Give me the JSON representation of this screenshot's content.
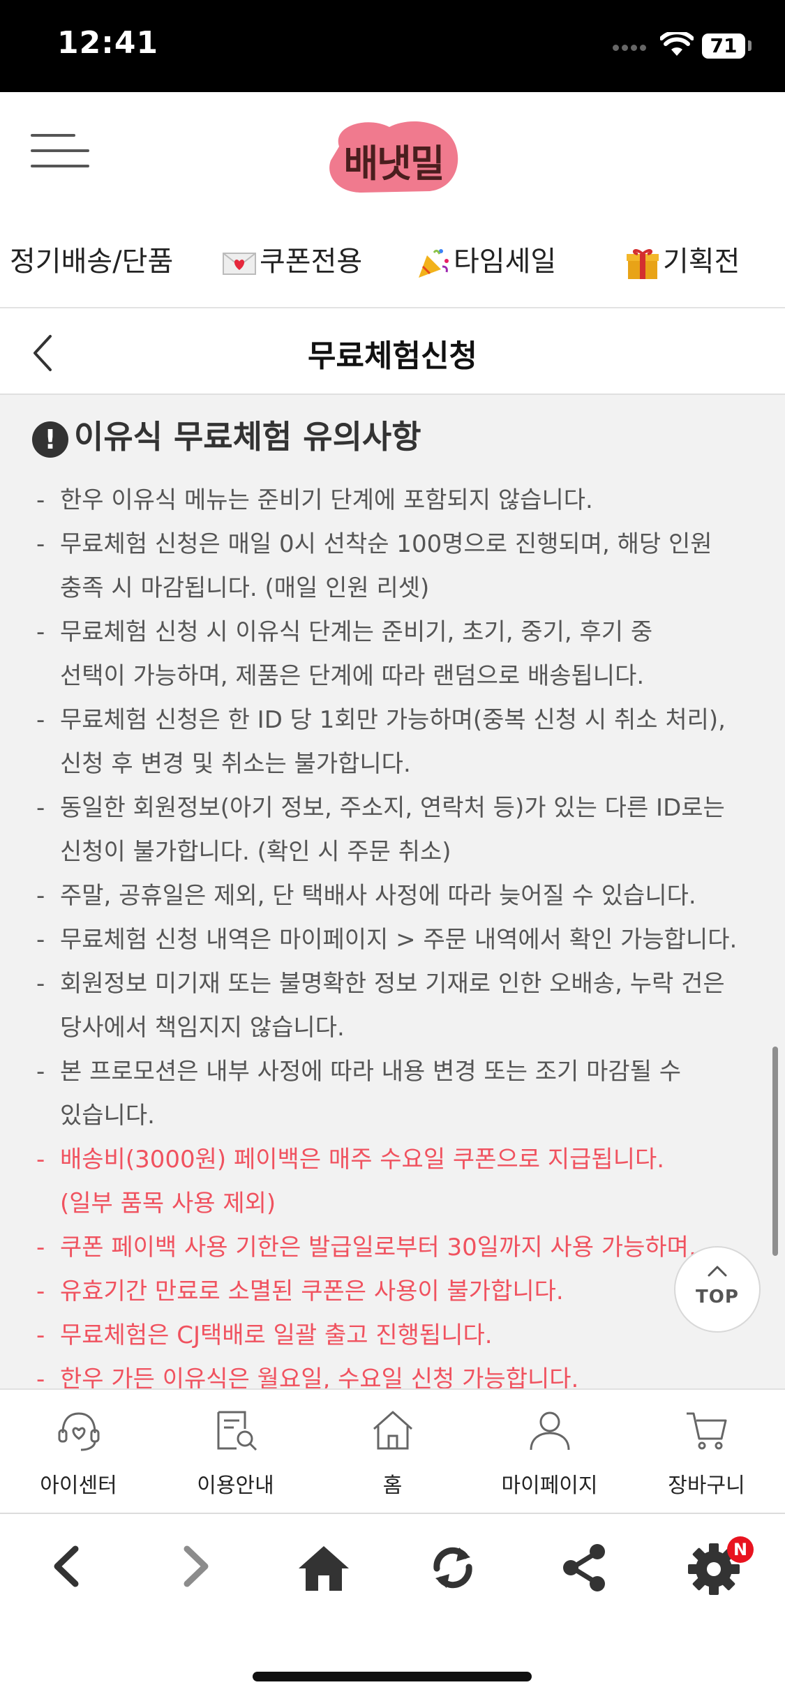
{
  "status_bar": {
    "time": "12:41",
    "battery": "71"
  },
  "header": {
    "logo_text": "배냇밀",
    "logo_color": "#f07a8e"
  },
  "category_nav": {
    "items": [
      {
        "label": "정기배송/단품",
        "icon": ""
      },
      {
        "label": "쿠폰전용",
        "icon": "love-letter-icon"
      },
      {
        "label": "타임세일",
        "icon": "party-popper-icon"
      },
      {
        "label": "기획전",
        "icon": "gift-icon"
      }
    ]
  },
  "title_bar": {
    "title": "무료체험신청"
  },
  "notice": {
    "heading": "이유식 무료체험 유의사항",
    "lines": [
      {
        "text": "한우 이유식 메뉴는 준비기 단계에 포함되지 않습니다.",
        "bullet": true,
        "red": false
      },
      {
        "text": "무료체험 신청은 매일 0시 선착순 100명으로 진행되며, 해당 인원",
        "bullet": true,
        "red": false
      },
      {
        "text": "충족 시 마감됩니다. (매일 인원 리셋)",
        "bullet": false,
        "red": false
      },
      {
        "text": "무료체험 신청 시 이유식 단계는 준비기, 초기, 중기, 후기 중",
        "bullet": true,
        "red": false
      },
      {
        "text": "선택이 가능하며, 제품은 단계에 따라 랜덤으로 배송됩니다.",
        "bullet": false,
        "red": false
      },
      {
        "text": "무료체험 신청은 한 ID 당 1회만 가능하며(중복 신청 시 취소 처리),",
        "bullet": true,
        "red": false
      },
      {
        "text": "신청 후 변경 및 취소는 불가합니다.",
        "bullet": false,
        "red": false
      },
      {
        "text": "동일한 회원정보(아기 정보, 주소지, 연락처 등)가 있는 다른 ID로는",
        "bullet": true,
        "red": false
      },
      {
        "text": "신청이 불가합니다. (확인 시 주문 취소)",
        "bullet": false,
        "red": false
      },
      {
        "text": "주말, 공휴일은 제외, 단 택배사 사정에 따라 늦어질 수 있습니다.",
        "bullet": true,
        "red": false
      },
      {
        "text": "무료체험 신청 내역은 마이페이지 > 주문 내역에서 확인 가능합니다.",
        "bullet": true,
        "red": false
      },
      {
        "text": "회원정보 미기재 또는 불명확한 정보 기재로 인한 오배송, 누락 건은",
        "bullet": true,
        "red": false
      },
      {
        "text": "당사에서 책임지지 않습니다.",
        "bullet": false,
        "red": false
      },
      {
        "text": "본 프로모션은 내부 사정에 따라 내용 변경 또는 조기 마감될 수",
        "bullet": true,
        "red": false
      },
      {
        "text": "있습니다.",
        "bullet": false,
        "red": false
      },
      {
        "text": "배송비(3000원) 페이백은 매주 수요일 쿠폰으로 지급됩니다.",
        "bullet": true,
        "red": true
      },
      {
        "text": "(일부 품목 사용 제외)",
        "bullet": false,
        "red": true
      },
      {
        "text": "쿠폰 페이백 사용 기한은 발급일로부터 30일까지 사용 가능하며,",
        "bullet": true,
        "red": true
      },
      {
        "text": "유효기간 만료로 소멸된 쿠폰은 사용이 불가합니다.",
        "bullet": true,
        "red": true
      },
      {
        "text": "무료체험은 CJ택배로 일괄 출고 진행됩니다.",
        "bullet": true,
        "red": true
      },
      {
        "text": "한우 가든 이유식은 월요일, 수요일 신청 가능합니다.",
        "bullet": true,
        "red": true
      }
    ]
  },
  "top_button": {
    "label": "TOP"
  },
  "tab_bar": {
    "items": [
      {
        "label": "아이센터",
        "icon": "headset-heart-icon"
      },
      {
        "label": "이용안내",
        "icon": "document-search-icon"
      },
      {
        "label": "홈",
        "icon": "home-icon"
      },
      {
        "label": "마이페이지",
        "icon": "person-icon"
      },
      {
        "label": "장바구니",
        "icon": "cart-icon"
      }
    ]
  },
  "browser_bar": {
    "settings_badge": "N"
  }
}
